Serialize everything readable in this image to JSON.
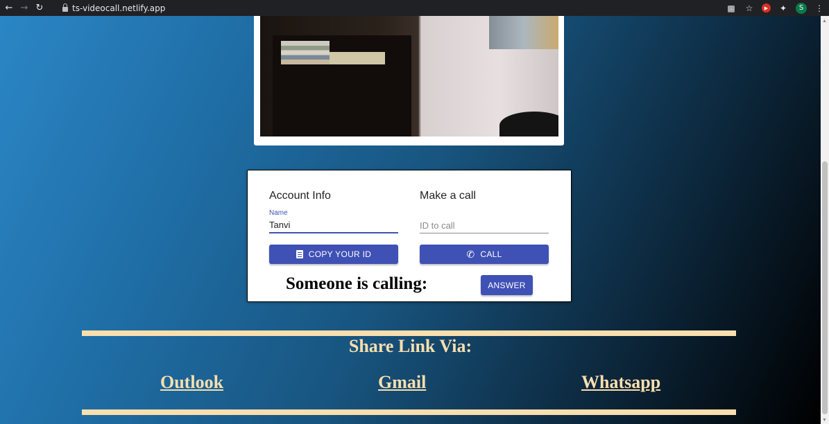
{
  "browser": {
    "url": "ts-videocall.netlify.app",
    "profile_initial": "S",
    "icons": [
      "back-icon",
      "forward-icon",
      "reload-icon",
      "lock-icon",
      "camera-icon",
      "star-icon",
      "extension-icon",
      "puzzle-icon",
      "menu-icon"
    ]
  },
  "account": {
    "title": "Account Info",
    "name_label": "Name",
    "name_value": "Tanvi",
    "copy_button": "COPY YOUR ID"
  },
  "call": {
    "title": "Make a call",
    "id_placeholder": "ID to call",
    "call_button": "CALL"
  },
  "incoming": {
    "text": "Someone is calling:",
    "answer_button": "ANSWER"
  },
  "share": {
    "title": "Share Link Via:",
    "links": [
      "Outlook",
      "Gmail",
      "Whatsapp"
    ]
  },
  "colors": {
    "primary": "#3f51b5",
    "accent_cream": "#f9dfae"
  }
}
